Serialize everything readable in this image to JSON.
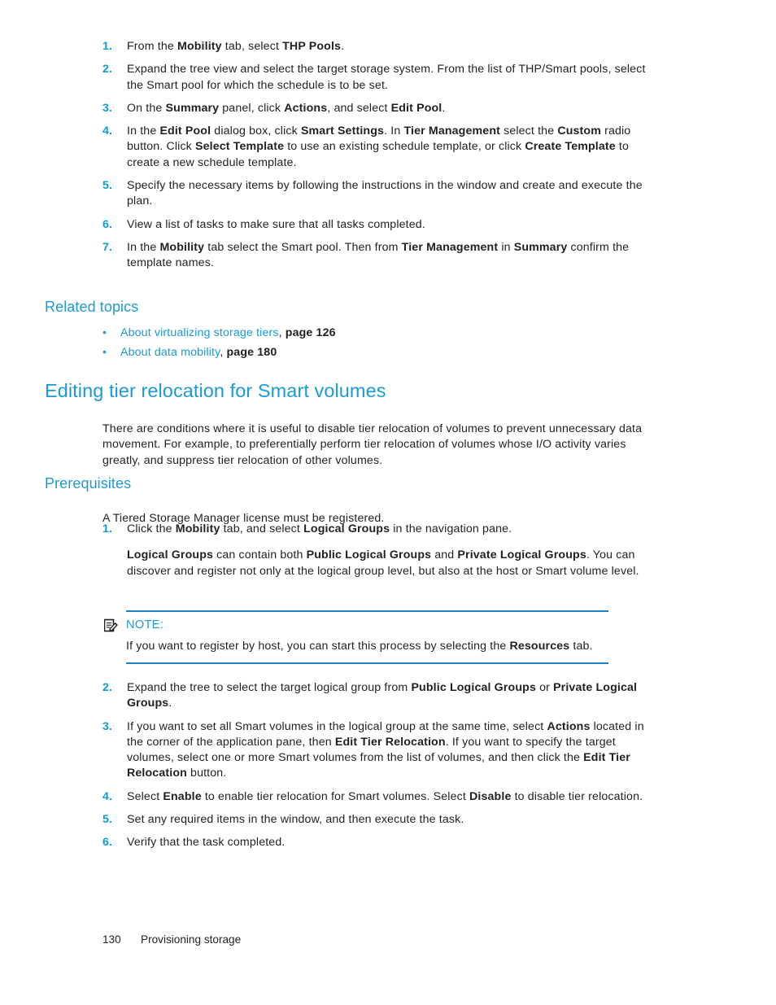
{
  "colors": {
    "accent_blue": "#1b9ad6",
    "list_number_blue": "#0a9bdc",
    "rule_blue": "#1b82c4",
    "body_text": "#231f20"
  },
  "steps_top": [
    {
      "num": "1.",
      "runs": [
        {
          "t": "From the ",
          "b": false
        },
        {
          "t": "Mobility",
          "b": true
        },
        {
          "t": " tab, select ",
          "b": false
        },
        {
          "t": "THP Pools",
          "b": true
        },
        {
          "t": ".",
          "b": false
        }
      ]
    },
    {
      "num": "2.",
      "runs": [
        {
          "t": "Expand the tree view and select the target storage system. From the list of THP/Smart pools, select the Smart pool for which the schedule is to be set.",
          "b": false
        }
      ]
    },
    {
      "num": "3.",
      "runs": [
        {
          "t": "On the ",
          "b": false
        },
        {
          "t": "Summary",
          "b": true
        },
        {
          "t": " panel, click ",
          "b": false
        },
        {
          "t": "Actions",
          "b": true
        },
        {
          "t": ", and select ",
          "b": false
        },
        {
          "t": "Edit Pool",
          "b": true
        },
        {
          "t": ".",
          "b": false
        }
      ]
    },
    {
      "num": "4.",
      "runs": [
        {
          "t": "In the ",
          "b": false
        },
        {
          "t": "Edit Pool",
          "b": true
        },
        {
          "t": " dialog box, click ",
          "b": false
        },
        {
          "t": "Smart Settings",
          "b": true
        },
        {
          "t": ". In ",
          "b": false
        },
        {
          "t": "Tier Management",
          "b": true
        },
        {
          "t": " select the ",
          "b": false
        },
        {
          "t": "Custom",
          "b": true
        },
        {
          "t": " radio button. Click ",
          "b": false
        },
        {
          "t": "Select Template",
          "b": true
        },
        {
          "t": " to use an existing schedule template, or click ",
          "b": false
        },
        {
          "t": "Create Template",
          "b": true
        },
        {
          "t": " to create a new schedule template.",
          "b": false
        }
      ]
    },
    {
      "num": "5.",
      "runs": [
        {
          "t": "Specify the necessary items by following the instructions in the window and create and execute the plan.",
          "b": false
        }
      ]
    },
    {
      "num": "6.",
      "runs": [
        {
          "t": "View a list of tasks to make sure that all tasks completed.",
          "b": false
        }
      ]
    },
    {
      "num": "7.",
      "runs": [
        {
          "t": "In the ",
          "b": false
        },
        {
          "t": "Mobility",
          "b": true
        },
        {
          "t": " tab select the Smart pool. Then from ",
          "b": false
        },
        {
          "t": "Tier Management",
          "b": true
        },
        {
          "t": " in ",
          "b": false
        },
        {
          "t": "Summary",
          "b": true
        },
        {
          "t": " confirm the template names.",
          "b": false
        }
      ]
    }
  ],
  "related_topics": {
    "heading": "Related topics",
    "bullet_glyph": "•",
    "items": [
      {
        "link": "About virtualizing storage tiers",
        "separator": ", ",
        "page": "page 126"
      },
      {
        "link": "About data mobility",
        "separator": ", ",
        "page": "page 180"
      }
    ]
  },
  "main_heading": "Editing tier relocation for Smart volumes",
  "intro_paragraph": "There are conditions where it is useful to disable tier relocation of volumes to prevent unnecessary data movement. For example, to preferentially perform tier relocation of volumes whose I/O activity varies greatly, and suppress tier relocation of other volumes.",
  "prerequisites": {
    "heading": "Prerequisites",
    "lead": "A Tiered Storage Manager license must be registered.",
    "step1": {
      "num": "1.",
      "para1": [
        {
          "t": "Click the ",
          "b": false
        },
        {
          "t": "Mobility",
          "b": true
        },
        {
          "t": " tab, and select ",
          "b": false
        },
        {
          "t": "Logical Groups",
          "b": true
        },
        {
          "t": " in the navigation pane.",
          "b": false
        }
      ],
      "para2": [
        {
          "t": "Logical Groups",
          "b": true
        },
        {
          "t": " can contain both ",
          "b": false
        },
        {
          "t": "Public Logical Groups",
          "b": true
        },
        {
          "t": " and ",
          "b": false
        },
        {
          "t": "Private Logical Groups",
          "b": true
        },
        {
          "t": ". You can discover and register not only at the logical group level, but also at the host or Smart volume level.",
          "b": false
        }
      ]
    }
  },
  "note": {
    "icon_name": "note-pencil-icon",
    "label": "NOTE:",
    "runs": [
      {
        "t": "If you want to register by host, you can start this process by selecting the ",
        "b": false
      },
      {
        "t": "Resources",
        "b": true
      },
      {
        "t": " tab.",
        "b": false
      }
    ]
  },
  "steps_bottom": [
    {
      "num": "2.",
      "runs": [
        {
          "t": "Expand the tree to select the target logical group from ",
          "b": false
        },
        {
          "t": "Public Logical Groups",
          "b": true
        },
        {
          "t": " or ",
          "b": false
        },
        {
          "t": "Private Logical Groups",
          "b": true
        },
        {
          "t": ".",
          "b": false
        }
      ]
    },
    {
      "num": "3.",
      "runs": [
        {
          "t": "If you want to set all Smart volumes in the logical group at the same time, select ",
          "b": false
        },
        {
          "t": "Actions",
          "b": true
        },
        {
          "t": " located in the corner of the application pane, then ",
          "b": false
        },
        {
          "t": "Edit Tier Relocation",
          "b": true
        },
        {
          "t": ". If you want to specify the target volumes, select one or more Smart volumes from the list of volumes, and then click the ",
          "b": false
        },
        {
          "t": "Edit Tier Relocation",
          "b": true
        },
        {
          "t": " button.",
          "b": false
        }
      ]
    },
    {
      "num": "4.",
      "runs": [
        {
          "t": "Select ",
          "b": false
        },
        {
          "t": "Enable",
          "b": true
        },
        {
          "t": " to enable tier relocation for Smart volumes. Select ",
          "b": false
        },
        {
          "t": "Disable",
          "b": true
        },
        {
          "t": " to disable tier relocation.",
          "b": false
        }
      ]
    },
    {
      "num": "5.",
      "runs": [
        {
          "t": "Set any required items in the window, and then execute the task.",
          "b": false
        }
      ]
    },
    {
      "num": "6.",
      "runs": [
        {
          "t": "Verify that the task completed.",
          "b": false
        }
      ]
    }
  ],
  "footer": {
    "page_number": "130",
    "chapter": "Provisioning storage"
  }
}
